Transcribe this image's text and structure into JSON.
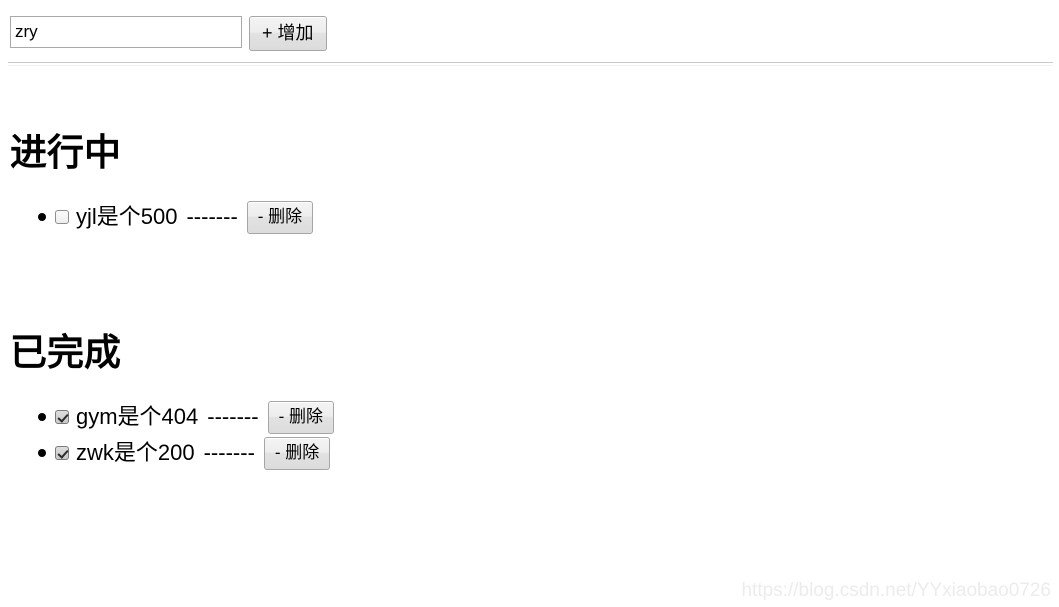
{
  "add_bar": {
    "input_value": "zry",
    "input_placeholder": "",
    "add_button_label": "+ 增加"
  },
  "sections": [
    {
      "key": "pending",
      "title": "进行中",
      "items": [
        {
          "text": "yjl是个500",
          "dashes": "-------",
          "checked": false,
          "delete_label": "- 删除"
        }
      ]
    },
    {
      "key": "done",
      "title": "已完成",
      "items": [
        {
          "text": "gym是个404",
          "dashes": "-------",
          "checked": true,
          "delete_label": "- 删除"
        },
        {
          "text": "zwk是个200",
          "dashes": "-------",
          "checked": true,
          "delete_label": "- 删除"
        }
      ]
    }
  ],
  "watermark": "https://blog.csdn.net/YYxiaobao0726"
}
